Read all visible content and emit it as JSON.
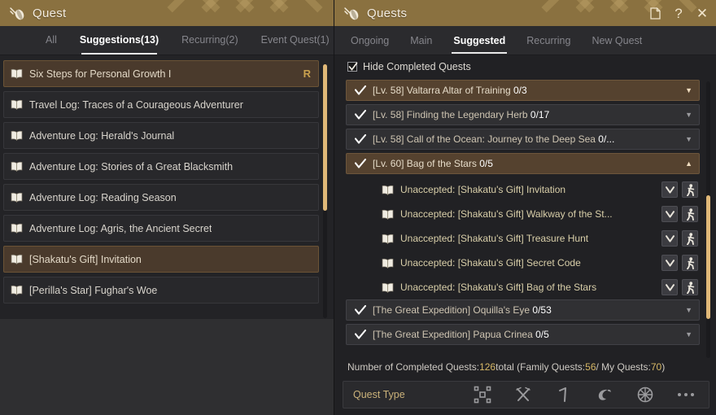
{
  "left": {
    "titlebar": {
      "title": "Quest",
      "icon": "scroll-icon"
    },
    "tabs": [
      {
        "label": "All",
        "active": false
      },
      {
        "label": "Suggestions(13)",
        "active": true
      },
      {
        "label": "Recurring(2)",
        "active": false
      },
      {
        "label": "Event Quest(1)",
        "active": false
      }
    ],
    "items": [
      {
        "label": "Six Steps for Personal Growth I",
        "selected": true,
        "badge": "R"
      },
      {
        "label": "Travel Log: Traces of a Courageous Adventurer",
        "selected": false,
        "badge": ""
      },
      {
        "label": "Adventure Log: Herald's Journal",
        "selected": false,
        "badge": ""
      },
      {
        "label": "Adventure Log: Stories of a Great Blacksmith",
        "selected": false,
        "badge": ""
      },
      {
        "label": "Adventure Log: Reading Season",
        "selected": false,
        "badge": ""
      },
      {
        "label": "Adventure Log: Agris, the Ancient Secret",
        "selected": false,
        "badge": ""
      },
      {
        "label": "[Shakatu's Gift] Invitation",
        "selected": true,
        "badge": ""
      },
      {
        "label": "[Perilla's Star] Fughar's Woe",
        "selected": false,
        "badge": ""
      }
    ]
  },
  "right": {
    "titlebar": {
      "title": "Quests",
      "icon": "scroll-icon",
      "actions": [
        {
          "name": "note-icon",
          "glyph": "❐"
        },
        {
          "name": "help-icon",
          "glyph": "?"
        },
        {
          "name": "close-icon",
          "glyph": "✕"
        }
      ]
    },
    "tabs": [
      {
        "label": "Ongoing",
        "active": false
      },
      {
        "label": "Main",
        "active": false
      },
      {
        "label": "Suggested",
        "active": true
      },
      {
        "label": "Recurring",
        "active": false
      },
      {
        "label": "New Quest",
        "active": false
      }
    ],
    "filter": {
      "label": "Hide Completed Quests",
      "checked": true
    },
    "quests": [
      {
        "type": "quest",
        "label": "[Lv. 58] Valtarra Altar of Training ",
        "frac": "0/3",
        "highlight": true,
        "expanded": false
      },
      {
        "type": "quest",
        "label": "[Lv. 58] Finding the Legendary Herb ",
        "frac": "0/17",
        "highlight": false,
        "expanded": false
      },
      {
        "type": "quest",
        "label": "[Lv. 58] Call of the Ocean: Journey to the Deep Sea ",
        "frac": "0/...",
        "highlight": false,
        "expanded": false
      },
      {
        "type": "quest",
        "label": "[Lv. 60] Bag of the Stars ",
        "frac": "0/5",
        "highlight": true,
        "expanded": true
      },
      {
        "type": "sub",
        "label": "Unaccepted: [Shakatu's Gift] Invitation"
      },
      {
        "type": "sub",
        "label": "Unaccepted: [Shakatu's Gift] Walkway of the St..."
      },
      {
        "type": "sub",
        "label": "Unaccepted: [Shakatu's Gift] Treasure Hunt"
      },
      {
        "type": "sub",
        "label": "Unaccepted: [Shakatu's Gift] Secret Code"
      },
      {
        "type": "sub",
        "label": "Unaccepted: [Shakatu's Gift] Bag of the Stars"
      },
      {
        "type": "quest",
        "label": "[The Great Expedition] Oquilla's Eye ",
        "frac": "0/53",
        "highlight": false,
        "expanded": false
      },
      {
        "type": "quest",
        "label": "[The Great Expedition] Papua Crinea ",
        "frac": "0/5",
        "highlight": false,
        "expanded": false
      }
    ],
    "summary": {
      "prefix": "Number of Completed Quests: ",
      "total": "126",
      "mid": " total (Family Quests: ",
      "family": "56",
      "mid2": " / My Quests: ",
      "mine": "70",
      "suffix": ")"
    },
    "footer": {
      "label": "Quest Type",
      "icons": [
        {
          "name": "node-network-icon"
        },
        {
          "name": "crossed-swords-icon"
        },
        {
          "name": "horn-icon"
        },
        {
          "name": "fish-icon"
        },
        {
          "name": "wheel-icon"
        },
        {
          "name": "more-options-icon"
        }
      ]
    },
    "sub_buttons": {
      "expand": "chevron-down-icon",
      "track": "walking-person-icon"
    }
  },
  "colors": {
    "gold_header": "#8a7140",
    "accent": "#d7b866",
    "scroll_thumb": "#e0b878",
    "highlight_row": "#55422f",
    "panel_bg": "#212124"
  }
}
